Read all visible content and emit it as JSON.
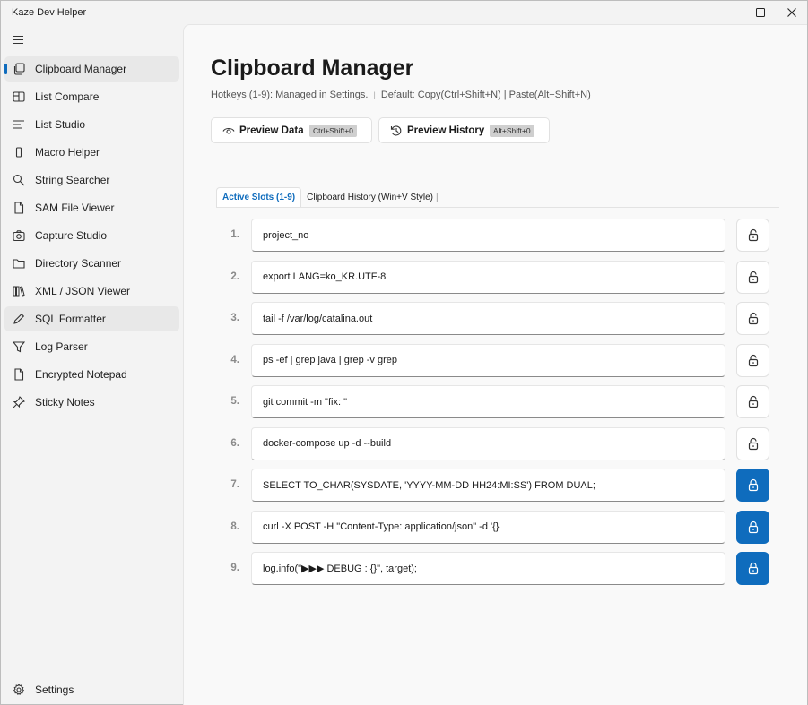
{
  "app": {
    "title": "Kaze Dev Helper",
    "accent": "#0f6cbd"
  },
  "window_controls": [
    "minimize-icon",
    "maximize-icon",
    "close-icon"
  ],
  "sidebar": {
    "items": [
      {
        "label": "Clipboard Manager",
        "icon": "clipboard-icon",
        "active": true
      },
      {
        "label": "List Compare",
        "icon": "compare-icon"
      },
      {
        "label": "List Studio",
        "icon": "list-icon"
      },
      {
        "label": "Macro Helper",
        "icon": "macro-icon"
      },
      {
        "label": "String Searcher",
        "icon": "search-icon"
      },
      {
        "label": "SAM File Viewer",
        "icon": "file-icon"
      },
      {
        "label": "Capture Studio",
        "icon": "camera-icon"
      },
      {
        "label": "Directory Scanner",
        "icon": "folder-icon"
      },
      {
        "label": "XML / JSON Viewer",
        "icon": "books-icon"
      },
      {
        "label": "SQL Formatter",
        "icon": "pencil-icon",
        "hover": true
      },
      {
        "label": "Log Parser",
        "icon": "filter-icon"
      },
      {
        "label": "Encrypted Notepad",
        "icon": "document-icon"
      },
      {
        "label": "Sticky Notes",
        "icon": "pin-icon"
      }
    ],
    "settings_label": "Settings"
  },
  "main": {
    "title": "Clipboard Manager",
    "subtitle_left": "Hotkeys (1-9): Managed in Settings.",
    "subtitle_sep": "|",
    "subtitle_right": "Default: Copy(Ctrl+Shift+N) | Paste(Alt+Shift+N)",
    "preview_data": {
      "label": "Preview Data",
      "shortcut": "Ctrl+Shift+0"
    },
    "preview_history": {
      "label": "Preview History",
      "shortcut": "Alt+Shift+0"
    },
    "tabs": [
      {
        "label": "Active Slots (1-9)",
        "active": true
      },
      {
        "label": "Clipboard History (Win+V Style)",
        "active": false
      }
    ],
    "tab_sep": "|",
    "slots": [
      {
        "num": "1.",
        "value": "project_no",
        "locked": false
      },
      {
        "num": "2.",
        "value": "export LANG=ko_KR.UTF-8",
        "locked": false
      },
      {
        "num": "3.",
        "value": "tail -f /var/log/catalina.out",
        "locked": false
      },
      {
        "num": "4.",
        "value": "ps -ef | grep java | grep -v grep",
        "locked": false
      },
      {
        "num": "5.",
        "value": "git commit -m \"fix: \"",
        "locked": false
      },
      {
        "num": "6.",
        "value": "docker-compose up -d --build",
        "locked": false
      },
      {
        "num": "7.",
        "value": "SELECT TO_CHAR(SYSDATE, 'YYYY-MM-DD HH24:MI:SS') FROM DUAL;",
        "locked": true
      },
      {
        "num": "8.",
        "value": "curl -X POST -H \"Content-Type: application/json\" -d '{}'",
        "locked": true
      },
      {
        "num": "9.",
        "value": "log.info(\"▶▶▶ DEBUG : {}\", target);",
        "locked": true
      }
    ]
  }
}
